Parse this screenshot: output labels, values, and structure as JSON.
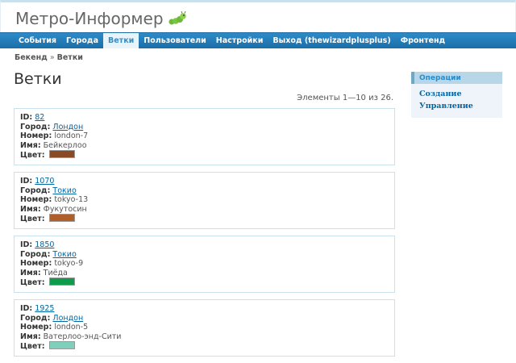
{
  "site": {
    "title": "Метро-Информер",
    "logo_icon": "caterpillar-icon"
  },
  "menu": [
    {
      "label": "События",
      "active": false
    },
    {
      "label": "Города",
      "active": false
    },
    {
      "label": "Ветки",
      "active": true
    },
    {
      "label": "Пользователи",
      "active": false
    },
    {
      "label": "Настройки",
      "active": false
    },
    {
      "label": "Выход (thewizardplusplus)",
      "active": false
    },
    {
      "label": "Фронтенд",
      "active": false
    }
  ],
  "breadcrumbs": {
    "parent": "Бекенд",
    "separator": "»",
    "current": "Ветки"
  },
  "page": {
    "title": "Ветки",
    "summary": "Элементы 1—10 из 26."
  },
  "labels": {
    "id": "ID:",
    "city": "Город:",
    "number": "Номер:",
    "name": "Имя:",
    "color": "Цвет:"
  },
  "items": [
    {
      "id": "82",
      "city": "Лондон",
      "number": "london-7",
      "name": "Бейкерлоо",
      "color": "#8a4a22"
    },
    {
      "id": "1070",
      "city": "Токио",
      "number": "tokyo-13",
      "name": "Фукутосин",
      "color": "#b05e2a"
    },
    {
      "id": "1850",
      "city": "Токио",
      "number": "tokyo-9",
      "name": "Тиёда",
      "color": "#0f9b4c"
    },
    {
      "id": "1925",
      "city": "Лондон",
      "number": "london-5",
      "name": "Ватерлоо-энд-Сити",
      "color": "#7fcfbd"
    }
  ],
  "sidebar": {
    "title": "Операции",
    "links": [
      "Создание",
      "Управление"
    ]
  }
}
